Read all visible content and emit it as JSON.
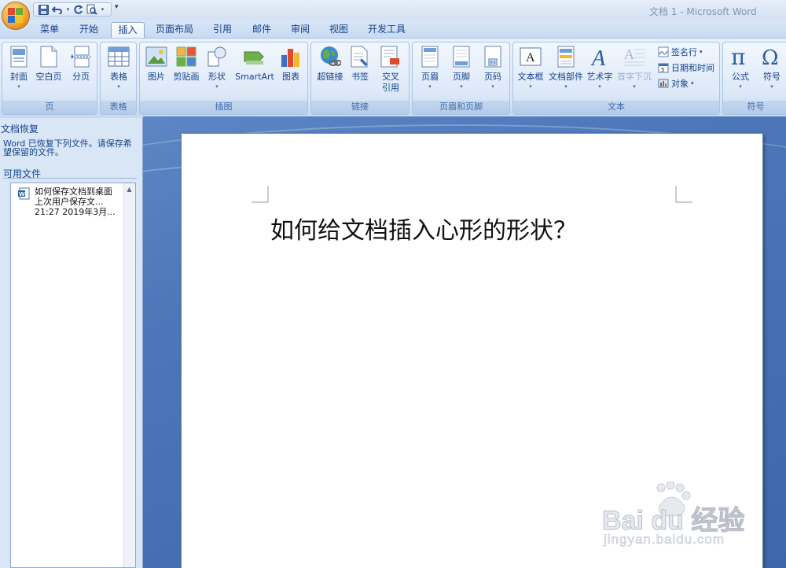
{
  "title_bar": {
    "title": "文档 1 - Microsoft Word"
  },
  "qat": {
    "more_glyph": "▾"
  },
  "tabs": [
    {
      "label": "菜单"
    },
    {
      "label": "开始"
    },
    {
      "label": "插入"
    },
    {
      "label": "页面布局"
    },
    {
      "label": "引用"
    },
    {
      "label": "邮件"
    },
    {
      "label": "审阅"
    },
    {
      "label": "视图"
    },
    {
      "label": "开发工具"
    }
  ],
  "active_tab": "插入",
  "ribbon": {
    "groups": {
      "pages": {
        "label": "页",
        "buttons": {
          "cover": "封面",
          "blank": "空白页",
          "break": "分页"
        }
      },
      "tables": {
        "label": "表格",
        "buttons": {
          "table": "表格"
        }
      },
      "illustrations": {
        "label": "插图",
        "buttons": {
          "picture": "图片",
          "clipart": "剪贴画",
          "shapes": "形状",
          "smartart": "SmartArt",
          "chart": "图表"
        }
      },
      "links": {
        "label": "链接",
        "buttons": {
          "hyperlink": "超链接",
          "bookmark": "书签",
          "crossref_line1": "交叉",
          "crossref_line2": "引用"
        }
      },
      "header_footer": {
        "label": "页眉和页脚",
        "buttons": {
          "header": "页眉",
          "footer": "页脚",
          "page_number": "页码"
        }
      },
      "text": {
        "label": "文本",
        "buttons": {
          "textbox": "文本框",
          "quickparts": "文档部件",
          "wordart": "艺术字",
          "dropcap": "首字下沉",
          "signature": "签名行",
          "datetime": "日期和时间",
          "object": "对象"
        }
      },
      "symbols": {
        "label": "符号",
        "buttons": {
          "equation": "公式",
          "symbol": "符号"
        }
      }
    }
  },
  "recovery_pane": {
    "title": "文档恢复",
    "message": "Word 已恢复下列文件。请保存希望保留的文件。",
    "available_label": "可用文件",
    "files": [
      {
        "name": "如何保存文档到桌面",
        "status": "上次用户保存文...",
        "time": "21:27 2019年3月..."
      }
    ]
  },
  "document": {
    "heading": "如何给文档插入心形的形状？"
  },
  "watermark": {
    "brand": "Bai du 经验",
    "url": "jingyan.baidu.com"
  },
  "colors": {
    "ribbon_text": "#15428b",
    "doc_bg": "#4d77b8",
    "office_orange": "#f3a531"
  }
}
